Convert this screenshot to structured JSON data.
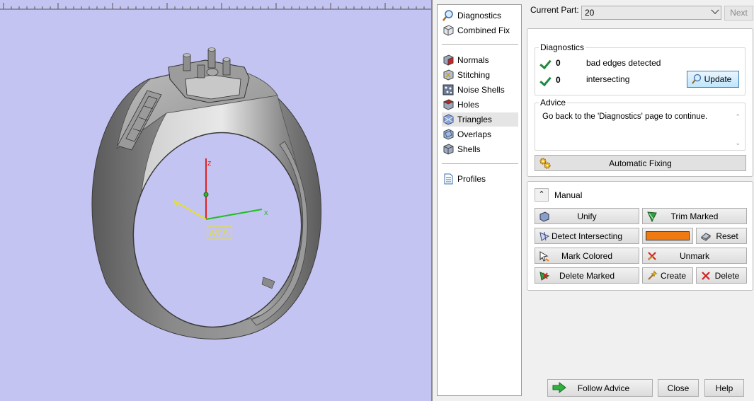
{
  "viewport": {
    "axis_labels": {
      "z": "z",
      "y": "y",
      "x": "x"
    },
    "wcs_label": "WCS"
  },
  "nav": {
    "items": [
      {
        "label": "Diagnostics",
        "icon": "magnifier-icon"
      },
      {
        "label": "Combined Fix",
        "icon": "cube-icon"
      },
      {
        "label": "Normals",
        "icon": "normals-cube-icon"
      },
      {
        "label": "Stitching",
        "icon": "stitching-cube-icon"
      },
      {
        "label": "Noise Shells",
        "icon": "noise-shells-icon"
      },
      {
        "label": "Holes",
        "icon": "holes-cube-icon"
      },
      {
        "label": "Triangles",
        "icon": "triangles-cube-icon",
        "selected": true
      },
      {
        "label": "Overlaps",
        "icon": "overlaps-cube-icon"
      },
      {
        "label": "Shells",
        "icon": "shells-cube-icon"
      },
      {
        "label": "Profiles",
        "icon": "document-icon"
      }
    ]
  },
  "top": {
    "current_part_label": "Current Part:",
    "current_part_value": "20",
    "next_label": "Next"
  },
  "diagnostics": {
    "title": "Diagnostics",
    "rows": [
      {
        "count": "0",
        "text": "bad edges detected"
      },
      {
        "count": "0",
        "text": "intersecting triangles detected"
      }
    ],
    "update_label": "Update",
    "advice_title": "Advice",
    "advice_text": "Go back to the 'Diagnostics' page to continue.",
    "automatic_fixing_label": "Automatic Fixing"
  },
  "manual": {
    "title": "Manual",
    "unify": "Unify",
    "trim_marked": "Trim Marked",
    "detect_intersecting": "Detect Intersecting",
    "color_swatch": "#f07a12",
    "reset": "Reset",
    "mark_colored": "Mark Colored",
    "unmark": "Unmark",
    "delete_marked": "Delete Marked",
    "create": "Create",
    "delete": "Delete"
  },
  "bottom": {
    "follow_advice": "Follow Advice",
    "close": "Close",
    "help": "Help"
  },
  "colors": {
    "viewport_bg": "#c4c4f2",
    "axis_z": "#e02020",
    "axis_x": "#20c020",
    "axis_y": "#e8e020",
    "accent_orange": "#f07a12"
  }
}
